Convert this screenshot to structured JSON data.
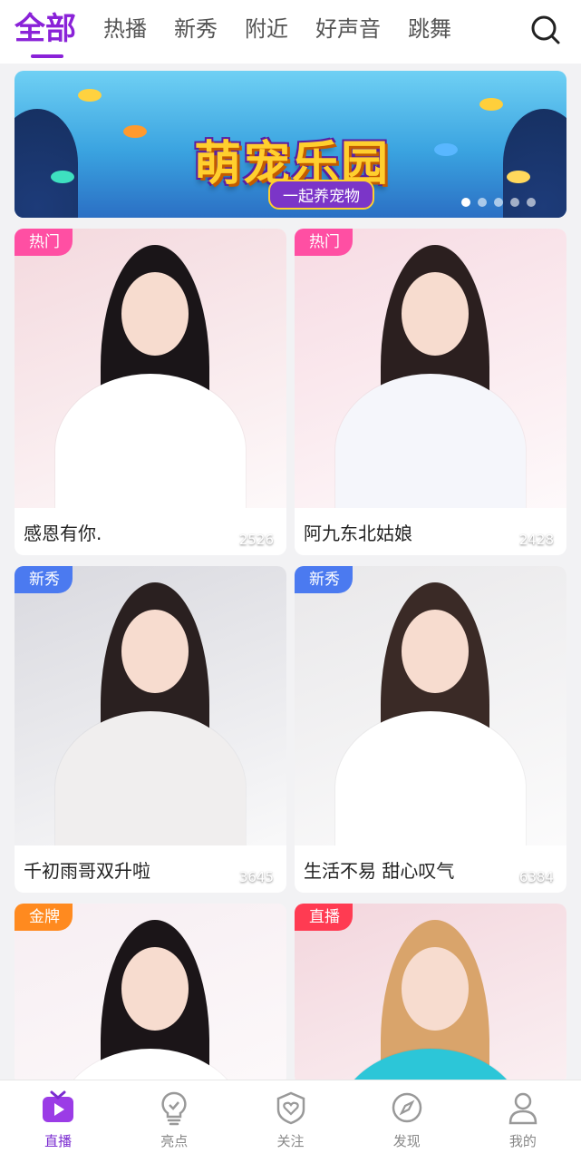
{
  "top_tabs": [
    "全部",
    "热播",
    "新秀",
    "附近",
    "好声音",
    "跳舞"
  ],
  "banner": {
    "title": "萌宠乐园",
    "subtitle": "一起养宠物",
    "page_count": 5,
    "active_page": 0
  },
  "cards": [
    {
      "badge": "热门",
      "badge_color": "#ff4fa3",
      "viewers": "2526",
      "caption": "感恩有你.",
      "bg": "#f4d9de",
      "hair": "#1a1518",
      "shirt": "#ffffff"
    },
    {
      "badge": "热门",
      "badge_color": "#ff4fa3",
      "viewers": "2428",
      "caption": "阿九东北姑娘",
      "bg": "#f7dbe3",
      "hair": "#2b1f1f",
      "shirt": "#f5f6fb"
    },
    {
      "badge": "新秀",
      "badge_color": "#4b7af0",
      "viewers": "3645",
      "caption": "千初雨哥双升啦",
      "bg": "#d9d9df",
      "hair": "#2a2020",
      "shirt": "#f0eeee"
    },
    {
      "badge": "新秀",
      "badge_color": "#4b7af0",
      "viewers": "6384",
      "caption": "生活不易 甜心叹气",
      "bg": "#e9e8ea",
      "hair": "#3a2a26",
      "shirt": "#ffffff"
    },
    {
      "badge": "金牌",
      "badge_color": "#ff8a1f",
      "viewers": "",
      "caption": "",
      "bg": "#f7eef2",
      "hair": "#1b1518",
      "shirt": "#ffffff"
    },
    {
      "badge": "直播",
      "badge_color": "#ff3b52",
      "viewers": "",
      "caption": "",
      "bg": "#f3d6dd",
      "hair": "#d9a46b",
      "shirt": "#2cc6d8"
    }
  ],
  "bottom_nav": [
    {
      "label": "直播",
      "icon": "live-tv-icon",
      "active": true
    },
    {
      "label": "亮点",
      "icon": "lightbulb-icon",
      "active": false
    },
    {
      "label": "关注",
      "icon": "heart-shield-icon",
      "active": false
    },
    {
      "label": "发现",
      "icon": "compass-icon",
      "active": false
    },
    {
      "label": "我的",
      "icon": "user-icon",
      "active": false
    }
  ],
  "colors": {
    "accent": "#8a22d8",
    "nav_active": "#7b2cd0"
  }
}
